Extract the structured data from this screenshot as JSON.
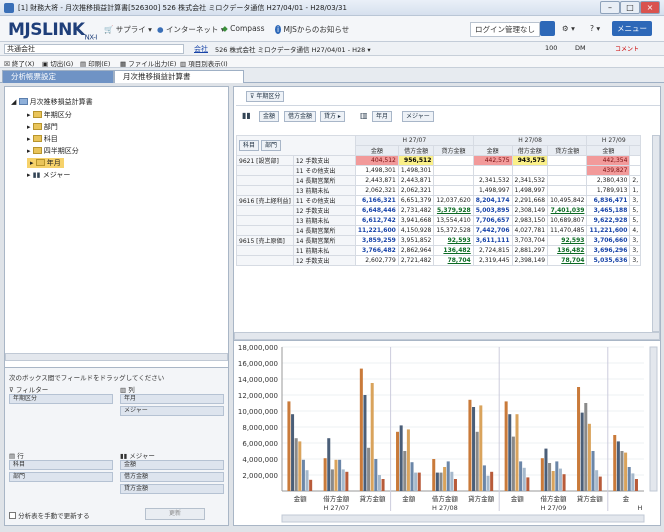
{
  "window": {
    "title": "[1] 財務大将 - 月次推移損益計算書[526300] 526 株式会社 ミロクデータ通信 H27/04/01 - H28/03/31"
  },
  "app": {
    "logo": "MJSLINK",
    "logo_sub": "NX-I",
    "menu": [
      {
        "label": "サプライ ▾",
        "icon": "cart-icon"
      },
      {
        "label": "インターネット ▾",
        "icon": "globe-icon"
      },
      {
        "label": "Compass",
        "icon": "compass-icon"
      },
      {
        "label": "MJSからのお知らせ",
        "icon": "info-icon"
      }
    ],
    "right": {
      "login": "ログイン管理なし",
      "search": "検索",
      "settings": "⚙ ▾",
      "help": "? ▾",
      "menu": "メニュー"
    }
  },
  "company_bar": {
    "field": "共通会社",
    "label": "会社",
    "company": "526 株式会社 ミロクデータ通信 H27/04/01 - H28 ▾",
    "user_count": "100",
    "user": "DM",
    "extra": "コメント"
  },
  "toolbar": {
    "items": [
      {
        "label": "終了(X)",
        "icon": "close-icon"
      },
      {
        "label": "切出(G)",
        "icon": "cut-icon"
      },
      {
        "label": "印刷(E)",
        "icon": "print-icon"
      },
      {
        "label": "ファイル出力(E)",
        "icon": "export-icon"
      },
      {
        "label": "項目別表示(I)",
        "icon": "list-icon"
      }
    ]
  },
  "tabs": [
    {
      "label": "分析帳票設定",
      "active": false
    },
    {
      "label": "月次推移損益計算書",
      "active": true
    }
  ],
  "tree": [
    {
      "label": "月次推移損益計算書",
      "level": 0
    },
    {
      "label": "年期区分",
      "level": 1
    },
    {
      "label": "部門",
      "level": 1
    },
    {
      "label": "科目",
      "level": 1
    },
    {
      "label": "四半期区分",
      "level": 1
    },
    {
      "label": "年月",
      "level": 1,
      "selected": true
    },
    {
      "label": "メジャー",
      "level": 1
    }
  ],
  "field_list": {
    "hint": "次のボックス間でフィールドをドラッグしてください",
    "filter_label": "フィルター",
    "filter_items": [
      "年期区分"
    ],
    "col_label": "列",
    "col_items": [
      "年月",
      "メジャー"
    ],
    "row_label": "行",
    "row_items": [
      "科目",
      "部門"
    ],
    "measure_label": "メジャー",
    "measure_items": [
      "金額",
      "借方金額",
      "貸方金額"
    ],
    "defer_label": "分析表を手動で更新する",
    "update_label": "更新"
  },
  "pivot": {
    "filter_chip": "年期区分",
    "toolbar_chips": [
      "金額",
      "借方金額",
      "貸方 ▸"
    ],
    "col_chips": [
      "年月",
      "メジャー"
    ],
    "row_chips": [
      "科目",
      "部門"
    ],
    "months": [
      "H 27/07",
      "H 27/08",
      "H 27/09"
    ],
    "measures": [
      "金額",
      "借方金額",
      "貸方金額"
    ],
    "rows": [
      {
        "dept": "9621 [設営部]",
        "code": "12",
        "acct": "手数支出",
        "v": [
          "404,512",
          "956,512",
          "",
          "442,575",
          "943,575",
          "",
          "442,354",
          ""
        ]
      },
      {
        "dept": "",
        "code": "11",
        "acct": "その他支出",
        "v": [
          "1,498,301",
          "1,498,301",
          "",
          "",
          "",
          "",
          "439,827",
          ""
        ]
      },
      {
        "dept": "",
        "code": "14",
        "acct": "長期営業所",
        "v": [
          "2,443,871",
          "2,443,871",
          "",
          "2,341,532",
          "2,341,532",
          "",
          "2,380,430",
          "2,"
        ]
      },
      {
        "dept": "",
        "code": "13",
        "acct": "前期未払",
        "v": [
          "2,062,321",
          "2,062,321",
          "",
          "1,498,997",
          "1,498,997",
          "",
          "1,789,913",
          "1,"
        ]
      },
      {
        "dept": "9616 [売上経利益]",
        "code": "11",
        "acct": "その他支出",
        "v": [
          "6,166,321",
          "6,651,379",
          "12,037,620",
          "8,204,174",
          "2,291,668",
          "10,495,842",
          "6,836,471",
          "3,"
        ]
      },
      {
        "dept": "",
        "code": "12",
        "acct": "手数支出",
        "v": [
          "6,648,446",
          "2,731,482",
          "5,379,928",
          "5,003,895",
          "2,308,149",
          "7,401,039",
          "3,465,188",
          "5,"
        ]
      },
      {
        "dept": "",
        "code": "13",
        "acct": "前期未払",
        "v": [
          "6,612,742",
          "3,941,668",
          "13,554,410",
          "7,706,657",
          "2,983,150",
          "10,689,807",
          "9,622,928",
          "5,"
        ]
      },
      {
        "dept": "",
        "code": "14",
        "acct": "長期営業所",
        "v": [
          "11,221,600",
          "4,150,928",
          "15,372,528",
          "7,442,706",
          "4,027,781",
          "11,470,485",
          "11,221,600",
          "4,"
        ]
      },
      {
        "dept": "9615 [売上原価]",
        "code": "14",
        "acct": "長期営業所",
        "v": [
          "3,859,259",
          "3,951,852",
          "92,593",
          "3,611,111",
          "3,703,704",
          "92,593",
          "3,706,660",
          "3,"
        ]
      },
      {
        "dept": "",
        "code": "11",
        "acct": "前期未払",
        "v": [
          "3,766,482",
          "2,862,964",
          "136,482",
          "2,724,815",
          "2,881,297",
          "136,482",
          "3,696,296",
          "3,"
        ]
      },
      {
        "dept": "",
        "code": "12",
        "acct": "手数支出",
        "v": [
          "2,602,779",
          "2,721,482",
          "78,704",
          "2,319,445",
          "2,398,149",
          "78,704",
          "5,035,636",
          "3,"
        ]
      }
    ]
  },
  "chart_data": {
    "type": "bar",
    "title": "",
    "xlabel": "",
    "ylabel": "",
    "ylim": [
      0,
      18000000
    ],
    "yticks": [
      "18,000,000",
      "16,000,000",
      "14,000,000",
      "12,000,000",
      "10,000,000",
      "8,000,000",
      "6,000,000",
      "4,000,000",
      "2,000,000"
    ],
    "categories": [
      "金額",
      "借方金額",
      "貸方金額",
      "金額",
      "借方金額",
      "貸方金額",
      "金額",
      "借方金額",
      "貸方金額",
      "金"
    ],
    "groups": [
      "H 27/07",
      "H 27/08",
      "H 27/09",
      "H"
    ],
    "series": [
      {
        "color": "#c97a3a",
        "values": [
          11200000,
          4100000,
          15300000,
          7400000,
          4000000,
          11400000,
          11200000,
          4100000,
          13000000,
          7000000
        ]
      },
      {
        "color": "#4a5e78",
        "values": [
          9600000,
          6600000,
          12000000,
          8200000,
          2300000,
          10500000,
          9600000,
          5300000,
          9800000,
          6200000
        ]
      },
      {
        "color": "#8a8a8a",
        "values": [
          6600000,
          2700000,
          5400000,
          5000000,
          2300000,
          7400000,
          6800000,
          3500000,
          11000000,
          5000000
        ]
      },
      {
        "color": "#d9a35c",
        "values": [
          6200000,
          3900000,
          13500000,
          7700000,
          3000000,
          10700000,
          9600000,
          2500000,
          8400000,
          4800000
        ]
      },
      {
        "color": "#6b86a8",
        "values": [
          3900000,
          3900000,
          4000000,
          3600000,
          3700000,
          3200000,
          3700000,
          3700000,
          5000000,
          3000000
        ]
      },
      {
        "color": "#a6b9cc",
        "values": [
          2600000,
          2700000,
          2000000,
          2300000,
          2400000,
          1900000,
          2900000,
          2800000,
          2600000,
          2200000
        ]
      },
      {
        "color": "#b85b3a",
        "values": [
          1400000,
          2400000,
          1500000,
          2300000,
          1500000,
          2400000,
          1700000,
          2100000,
          1800000,
          1500000
        ]
      }
    ]
  }
}
